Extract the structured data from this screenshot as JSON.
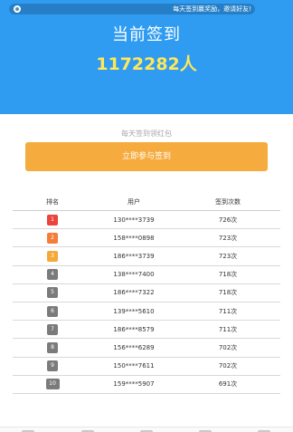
{
  "header": {
    "marquee": "每天签到赢奖励，邀请好友!",
    "title": "当前签到",
    "count": "1172282人"
  },
  "card": {
    "subtitle": "每天签到领红包",
    "join_label": "立即参与签到"
  },
  "table": {
    "columns": [
      "排名",
      "用户",
      "签到次数"
    ],
    "rows": [
      {
        "rank": "1",
        "user": "130****3739",
        "count": "726次",
        "color": "#e8453c"
      },
      {
        "rank": "2",
        "user": "158****0898",
        "count": "723次",
        "color": "#f47d39"
      },
      {
        "rank": "3",
        "user": "186****3739",
        "count": "723次",
        "color": "#f4a938"
      },
      {
        "rank": "4",
        "user": "138****7400",
        "count": "718次",
        "color": "#7b7b7b"
      },
      {
        "rank": "5",
        "user": "186****7322",
        "count": "718次",
        "color": "#7b7b7b"
      },
      {
        "rank": "6",
        "user": "139****5610",
        "count": "711次",
        "color": "#7b7b7b"
      },
      {
        "rank": "7",
        "user": "186****8579",
        "count": "711次",
        "color": "#7b7b7b"
      },
      {
        "rank": "8",
        "user": "156****6289",
        "count": "702次",
        "color": "#7b7b7b"
      },
      {
        "rank": "9",
        "user": "150****7611",
        "count": "702次",
        "color": "#7b7b7b"
      },
      {
        "rank": "10",
        "user": "159****5907",
        "count": "691次",
        "color": "#7b7b7b"
      }
    ]
  },
  "colors": {
    "hero_bg": "#2f9cf2",
    "count_color": "#ffe75a",
    "button_bg": "#f5ab3d"
  }
}
